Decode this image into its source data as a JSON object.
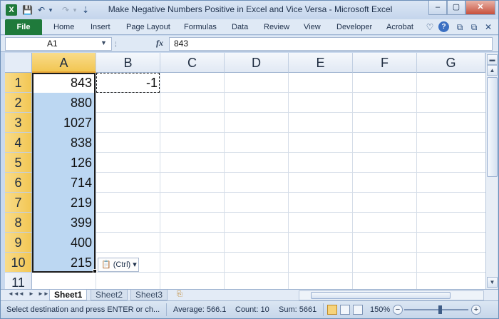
{
  "window": {
    "title": "Make Negative Numbers Positive in Excel and Vice Versa  -  Microsoft Excel",
    "buttons": {
      "minimize": "–",
      "maximize": "▢",
      "close": "✕"
    }
  },
  "quick_access": {
    "save": "💾",
    "undo": "↶",
    "undo_drop": "▾",
    "redo": "↷",
    "redo_drop": "▾",
    "customize": "⇣"
  },
  "ribbon": {
    "file": "File",
    "tabs": [
      "Home",
      "Insert",
      "Page Layout",
      "Formulas",
      "Data",
      "Review",
      "View",
      "Developer",
      "Acrobat"
    ],
    "icons": {
      "minimize_ribbon": "♡",
      "help": "?",
      "restore1": "⧉",
      "restore2": "⧉",
      "close": "✕"
    }
  },
  "formula_bar": {
    "name_box": "A1",
    "fx": "fx",
    "content": "843"
  },
  "grid": {
    "columns": [
      "A",
      "B",
      "C",
      "D",
      "E",
      "F",
      "G"
    ],
    "selected_column": "A",
    "rows": [
      "1",
      "2",
      "3",
      "4",
      "5",
      "6",
      "7",
      "8",
      "9",
      "10",
      "11"
    ],
    "selected_rows": 10,
    "column_a_values": [
      "843",
      "880",
      "1027",
      "838",
      "126",
      "714",
      "219",
      "399",
      "400",
      "215"
    ],
    "b1_value": "-1",
    "paste_options_label": "(Ctrl)",
    "paste_options_arrow": "▾"
  },
  "sheets": {
    "tabs": [
      "Sheet1",
      "Sheet2",
      "Sheet3"
    ],
    "active": "Sheet1",
    "nav": [
      "◄◄",
      "◄",
      "►",
      "►►"
    ]
  },
  "status_bar": {
    "message": "Select destination and press ENTER or ch...",
    "average": "Average: 566.1",
    "count": "Count: 10",
    "sum": "Sum: 5661",
    "zoom": "150%"
  }
}
